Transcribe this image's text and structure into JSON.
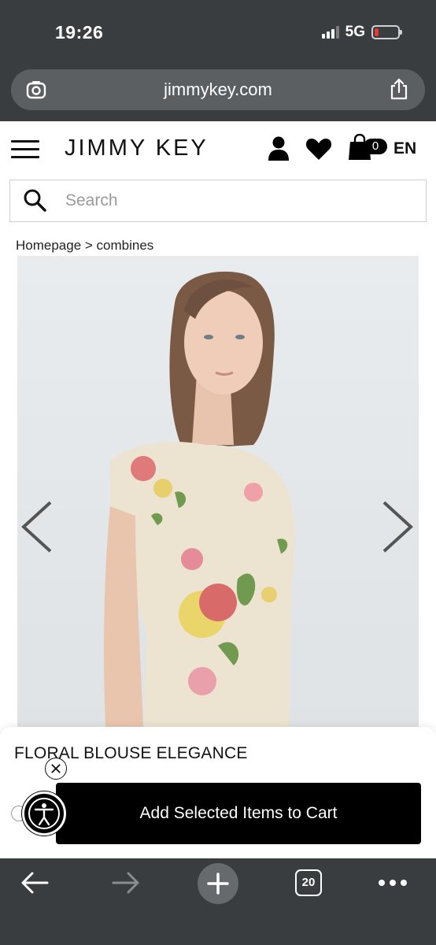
{
  "status_bar": {
    "time": "19:26",
    "network": "5G",
    "battery_level": 0.1,
    "signal_bars_active": 3
  },
  "browser": {
    "url": "jimmykey.com",
    "open_tabs": "20"
  },
  "header": {
    "logo": "JIMMY KEY",
    "cart_count": "0",
    "language": "EN",
    "icons": [
      "menu-icon",
      "user-icon",
      "heart-icon",
      "shopping-bag-icon"
    ]
  },
  "search": {
    "placeholder": "Search",
    "value": ""
  },
  "breadcrumb": {
    "home": "Homepage",
    "separator": " > ",
    "current": "combines"
  },
  "product": {
    "title": "FLORAL BLOUSE ELEGANCE",
    "add_to_cart_label": "Add Selected Items to Cart"
  },
  "colors": {
    "chrome": "#3a3d40",
    "urlbar": "#5b5f62",
    "accent": "#000000",
    "battery_low": "#e53935"
  }
}
